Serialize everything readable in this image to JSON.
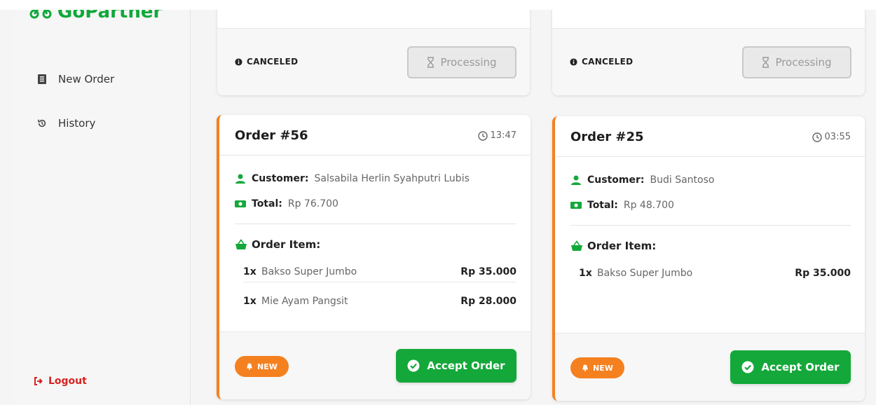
{
  "app": {
    "brand": "GoPartner"
  },
  "sidebar": {
    "items": [
      {
        "label": "New Order",
        "icon": "receipt-icon"
      },
      {
        "label": "History",
        "icon": "history-icon"
      }
    ],
    "logout": "Logout"
  },
  "top_cards": [
    {
      "status": "CANCELED",
      "button": "Processing"
    },
    {
      "status": "CANCELED",
      "button": "Processing"
    }
  ],
  "orders": [
    {
      "title": "Order #56",
      "time": "13:47",
      "customer_label": "Customer:",
      "customer": "Salsabila Herlin Syahputri Lubis",
      "total_label": "Total:",
      "total": "Rp 76.700",
      "items_label": "Order Item:",
      "items": [
        {
          "qty": "1x",
          "name": "Bakso Super Jumbo",
          "price": "Rp 35.000"
        },
        {
          "qty": "1x",
          "name": "Mie Ayam Pangsit",
          "price": "Rp 28.000"
        }
      ],
      "badge": "NEW",
      "action": "Accept Order"
    },
    {
      "title": "Order #25",
      "time": "03:55",
      "customer_label": "Customer:",
      "customer": "Budi Santoso",
      "total_label": "Total:",
      "total": "Rp 48.700",
      "items_label": "Order Item:",
      "items": [
        {
          "qty": "1x",
          "name": "Bakso Super Jumbo",
          "price": "Rp 35.000"
        }
      ],
      "badge": "NEW",
      "action": "Accept Order"
    }
  ],
  "colors": {
    "brand_green": "#14a83a",
    "accent_orange": "#f5801f",
    "danger_red": "#d62222"
  }
}
